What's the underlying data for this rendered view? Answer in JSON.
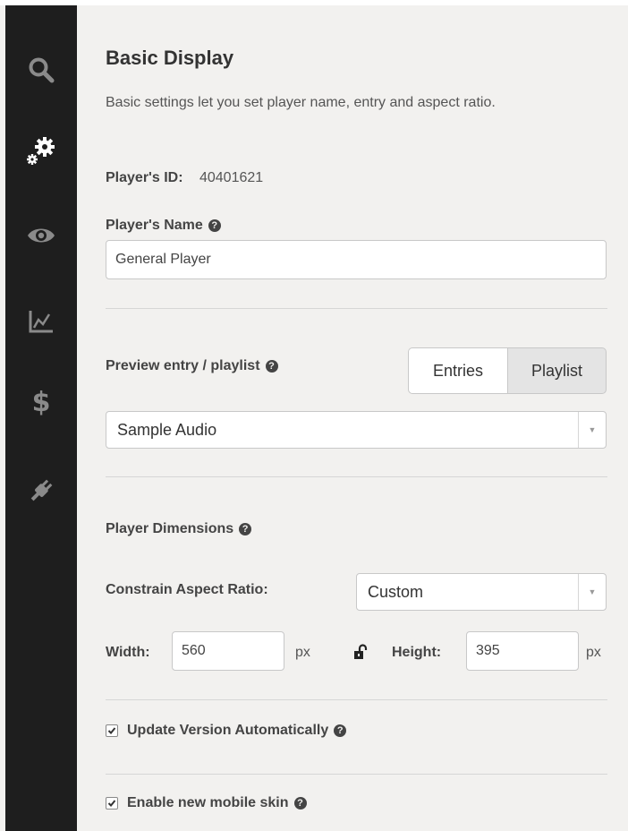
{
  "sidebar": {
    "items": [
      {
        "icon": "search-icon"
      },
      {
        "icon": "gears-icon",
        "active": true
      },
      {
        "icon": "eye-icon"
      },
      {
        "icon": "chart-icon"
      },
      {
        "icon": "dollar-icon"
      },
      {
        "icon": "plug-icon"
      }
    ]
  },
  "panel": {
    "title": "Basic Display",
    "description": "Basic settings let you set player name, entry and aspect ratio.",
    "player_id_label": "Player's ID:",
    "player_id_value": "40401621",
    "player_name_label": "Player's Name",
    "player_name_value": "General Player",
    "preview_label": "Preview entry / playlist",
    "toggle": {
      "entries": "Entries",
      "playlist": "Playlist",
      "selected": "Playlist"
    },
    "preview_select_value": "Sample Audio",
    "dimensions_label": "Player Dimensions",
    "constrain_label": "Constrain Aspect Ratio:",
    "constrain_value": "Custom",
    "width_label": "Width:",
    "width_value": "560",
    "width_unit": "px",
    "height_label": "Height:",
    "height_value": "395",
    "height_unit": "px",
    "update_version_label": "Update Version Automatically",
    "update_version_checked": true,
    "mobile_skin_label": "Enable new mobile skin",
    "mobile_skin_checked": true
  },
  "colors": {
    "sidebar_bg": "#1e1e1e",
    "icon": "#8a8a8a",
    "icon_active": "#ffffff",
    "panel_bg": "#f2f1ef"
  }
}
